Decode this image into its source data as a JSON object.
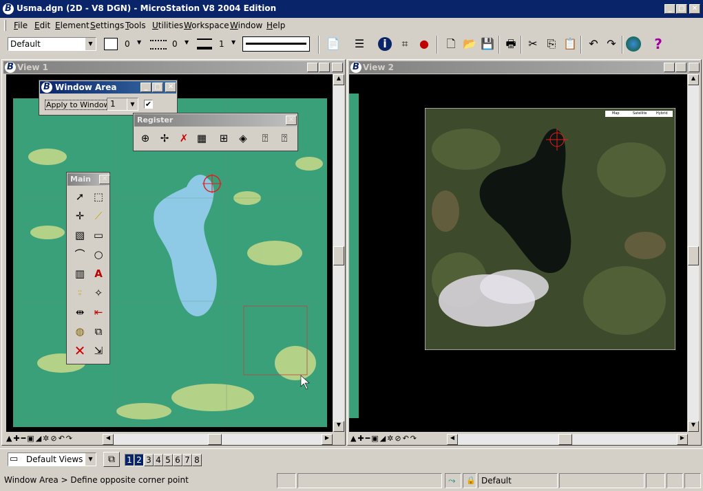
{
  "app": {
    "title": "Usma.dgn (2D - V8 DGN) - MicroStation V8 2004 Edition",
    "title_controls": [
      "_",
      "□",
      "✕"
    ]
  },
  "menu": [
    "File",
    "Edit",
    "Element",
    "Settings",
    "Tools",
    "Utilities",
    "Workspace",
    "Window",
    "Help"
  ],
  "attributes": {
    "level": "Default",
    "color": "0",
    "style": "0",
    "weight": "1"
  },
  "views": [
    {
      "title": "View 1"
    },
    {
      "title": "View 2"
    }
  ],
  "window_area": {
    "title": "Window Area",
    "label": "Apply to Window:",
    "window_value": "1",
    "checked": true
  },
  "register": {
    "title": "Register"
  },
  "main_palette": {
    "title": "Main"
  },
  "map_overlay": {
    "buttons": [
      "Map",
      "Satellite",
      "Hybrid"
    ]
  },
  "bottom": {
    "saved_views": "Default Views",
    "view_numbers": [
      "1",
      "2",
      "3",
      "4",
      "5",
      "6",
      "7",
      "8"
    ]
  },
  "status": {
    "prompt": "Window Area > Define opposite corner point",
    "level": "Default"
  },
  "colors": {
    "titlebar": "#0a246a",
    "map_green": "#3aa07a",
    "lake_blue": "#8ecae6",
    "marker_red": "#e02020"
  }
}
